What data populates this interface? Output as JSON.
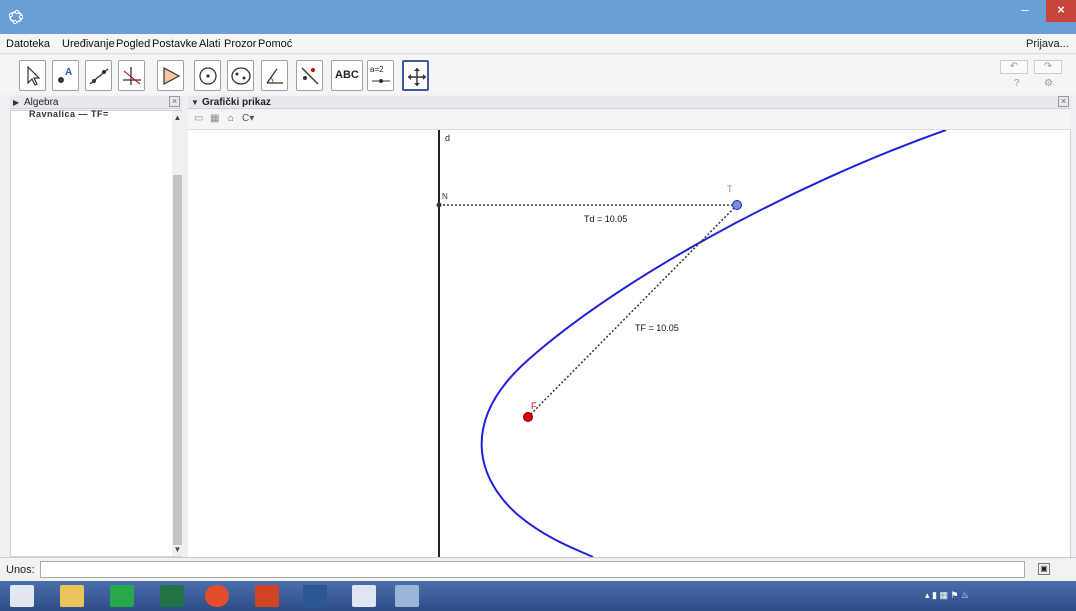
{
  "window": {
    "min_label": "–",
    "max_label": "□",
    "close_label": "×"
  },
  "menu": {
    "items": [
      "Datoteka",
      "Uređivanje",
      "Pogled",
      "Postavke",
      "Alati",
      "Prozor",
      "Pomoć"
    ],
    "signin": "Prijava..."
  },
  "toolbar": {
    "tools": [
      "move-tool",
      "point-tool",
      "line-tool",
      "perpendicular-tool",
      "polygon-tool",
      "circle-tool",
      "conic-tool",
      "angle-tool",
      "reflect-tool",
      "text-tool",
      "slider-tool",
      "move-view-tool"
    ],
    "text_tool_label": "ABC",
    "slider_tool_label": "a=2",
    "undo": "↶",
    "redo": "↷",
    "help": "?",
    "settings": "⚙"
  },
  "algebra": {
    "title": "Algebra",
    "clip_text": "Ravnalica — TF="
  },
  "graphics": {
    "title": "Grafički prikaz",
    "labels": {
      "line_d": "d",
      "point_N": "N",
      "point_T": "T",
      "point_F": "F",
      "Td": "Td = 10.05",
      "TF": "TF = 10.05"
    }
  },
  "input": {
    "label": "Unos:",
    "value": "",
    "help": "▣"
  },
  "colors": {
    "curve": "#1f1fe0",
    "focus": "#d40000",
    "point_T": "#7b8fd6",
    "titlebar": "#6a9fd6",
    "close": "#c7443c"
  }
}
